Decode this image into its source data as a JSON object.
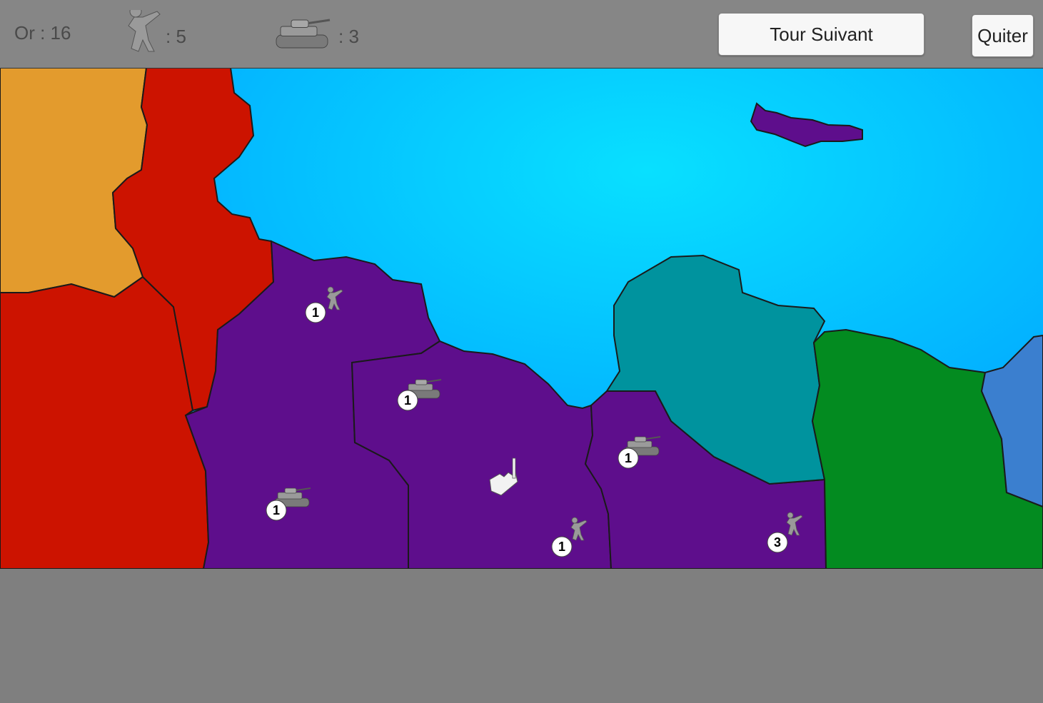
{
  "hud": {
    "gold_label": "Or : 16",
    "infantry_count": ": 5",
    "tank_count": ": 3",
    "next_turn_label": "Tour Suivant",
    "quit_label": "Quiter"
  },
  "colors": {
    "sea": "#00c8ff",
    "player": "#5e0e8c",
    "red": "#cc1300",
    "orange": "#e39b2d",
    "teal": "#00939e",
    "green": "#038b20",
    "blue": "#3b7fcf",
    "hud": "#868686",
    "background": "#7f7f7f"
  },
  "units": [
    {
      "type": "infantry",
      "count": "1"
    },
    {
      "type": "tank",
      "count": "1"
    },
    {
      "type": "tank",
      "count": "1"
    },
    {
      "type": "tank",
      "count": "1"
    },
    {
      "type": "infantry",
      "count": "1"
    },
    {
      "type": "infantry",
      "count": "3"
    }
  ]
}
